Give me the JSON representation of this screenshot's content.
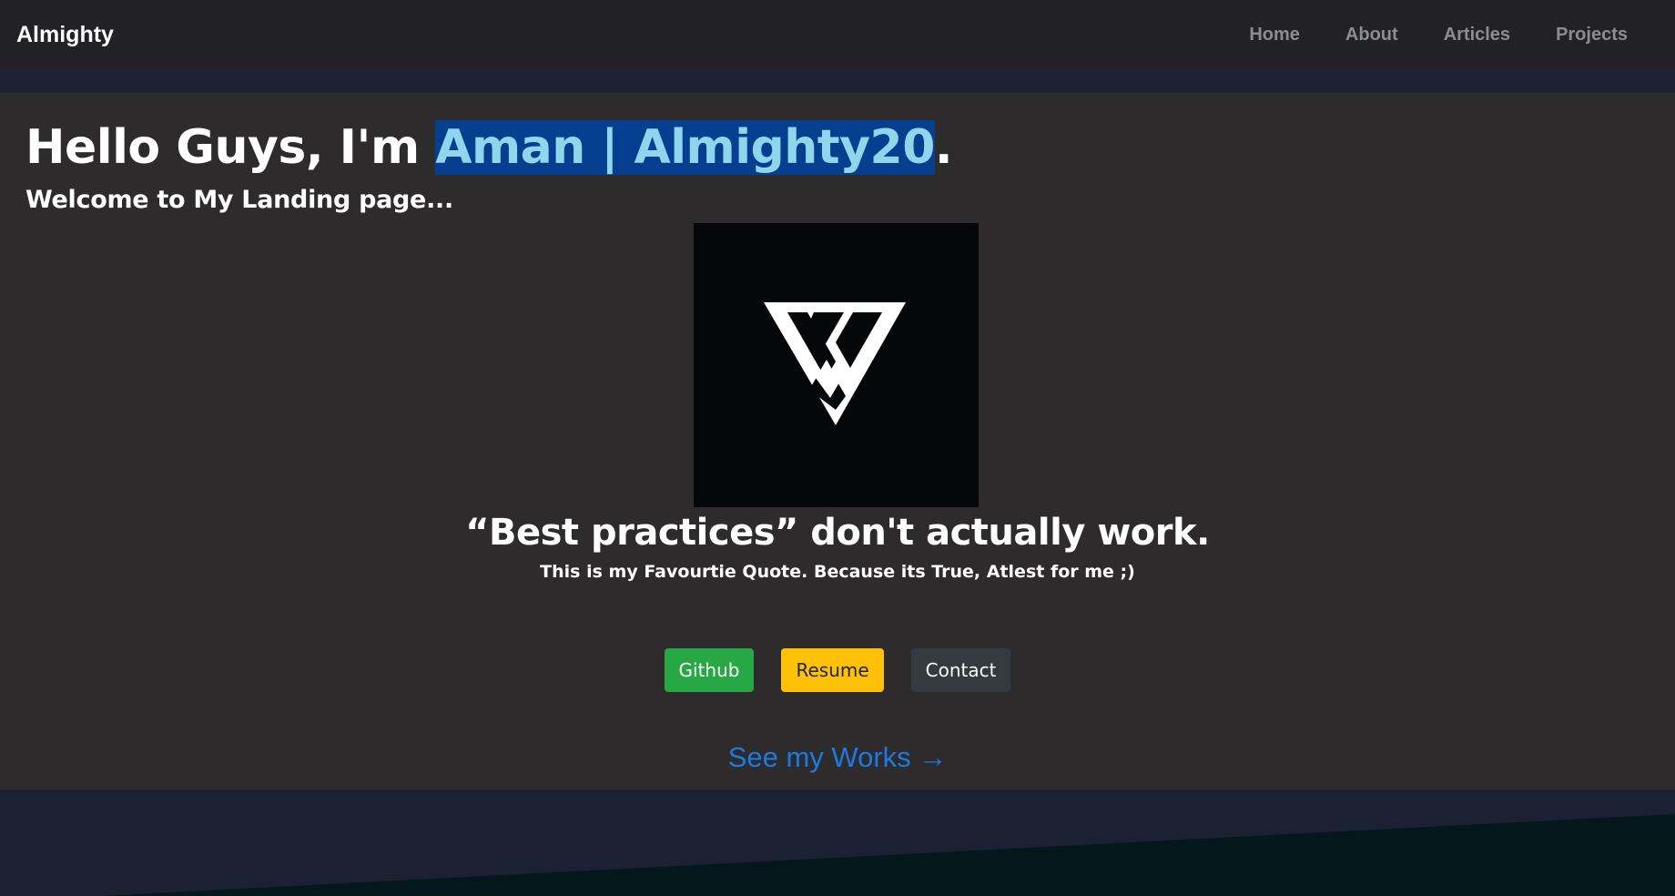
{
  "navbar": {
    "brand": "Almighty",
    "links": [
      "Home",
      "About",
      "Articles",
      "Projects"
    ]
  },
  "hero": {
    "heading_prefix": "Hello Guys, I'm ",
    "heading_highlight": "Aman | Almighty20",
    "heading_suffix": ".",
    "subheading": "Welcome to My Landing page...",
    "logo_icon": "v-triangle-logo",
    "quote": "“Best practices” don't actually work.",
    "quote_note": "This is my Favourtie Quote. Because its True, Atlest for me ;)"
  },
  "buttons": {
    "github": "Github",
    "resume": "Resume",
    "contact": "Contact"
  },
  "see_works": {
    "label": "See my Works",
    "arrow": "→"
  },
  "colors": {
    "navbar_bg": "#222226",
    "hero_bg": "#2d2b2c",
    "selection_bg": "#063f8f",
    "selection_text": "#8fd6ec",
    "github_green": "#28a745",
    "resume_yellow": "#ffc107",
    "contact_dark": "#343a40",
    "link_blue": "#1c7ae0",
    "footer_navy": "#1c2033",
    "footer_teal": "#04171b"
  }
}
